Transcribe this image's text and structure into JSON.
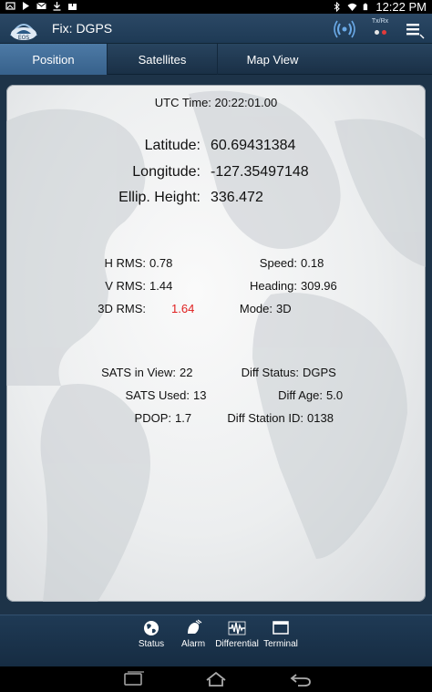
{
  "status_bar": {
    "time": "12:22 PM",
    "left_icons": [
      "photo-icon",
      "play-icon",
      "gmail-icon",
      "download-icon",
      "upload-icon"
    ],
    "right_icons": [
      "bluetooth-icon",
      "wifi-icon",
      "battery-icon"
    ]
  },
  "action_bar": {
    "title": "Fix: DGPS",
    "txrx_label": "Tx/Rx",
    "icons": [
      "app-logo-icon",
      "signal-icon",
      "txrx-icon",
      "menu-icon"
    ]
  },
  "tabs": [
    {
      "label": "Position",
      "active": true
    },
    {
      "label": "Satellites",
      "active": false
    },
    {
      "label": "Map View",
      "active": false
    }
  ],
  "position": {
    "utc_time": "UTC Time: 20:22:01.00",
    "latitude_label": "Latitude:",
    "latitude": "60.69431384",
    "longitude_label": "Longitude:",
    "longitude": "-127.35497148",
    "height_label": "Ellip. Height:",
    "height": "336.472",
    "hrms_label": "H RMS:",
    "hrms": "0.78",
    "vrms_label": "V RMS:",
    "vrms": "1.44",
    "rms3d_label": "3D RMS:",
    "rms3d": "1.64",
    "speed_label": "Speed:",
    "speed": "0.18",
    "heading_label": "Heading:",
    "heading": "309.96",
    "mode_label": "Mode:",
    "mode": "3D",
    "sats_view_label": "SATS in View:",
    "sats_view": "22",
    "sats_used_label": "SATS Used:",
    "sats_used": "13",
    "pdop_label": "PDOP:",
    "pdop": "1.7",
    "diff_status_label": "Diff Status:",
    "diff_status": "DGPS",
    "diff_age_label": "Diff Age:",
    "diff_age": "5.0",
    "diff_station_label": "Diff Station ID:",
    "diff_station": "0138"
  },
  "colors": {
    "alert_value": "#e02020",
    "action_bar": "#2b4865",
    "active_tab": "#4d7aa6"
  },
  "bottom_toolbar": [
    {
      "label": "Status",
      "icon": "globe-icon"
    },
    {
      "label": "Alarm",
      "icon": "alarm-icon"
    },
    {
      "label": "Differential",
      "icon": "differential-icon"
    },
    {
      "label": "Terminal",
      "icon": "terminal-icon"
    }
  ],
  "nav_bar": [
    "recent-apps-icon",
    "home-icon",
    "back-icon"
  ]
}
